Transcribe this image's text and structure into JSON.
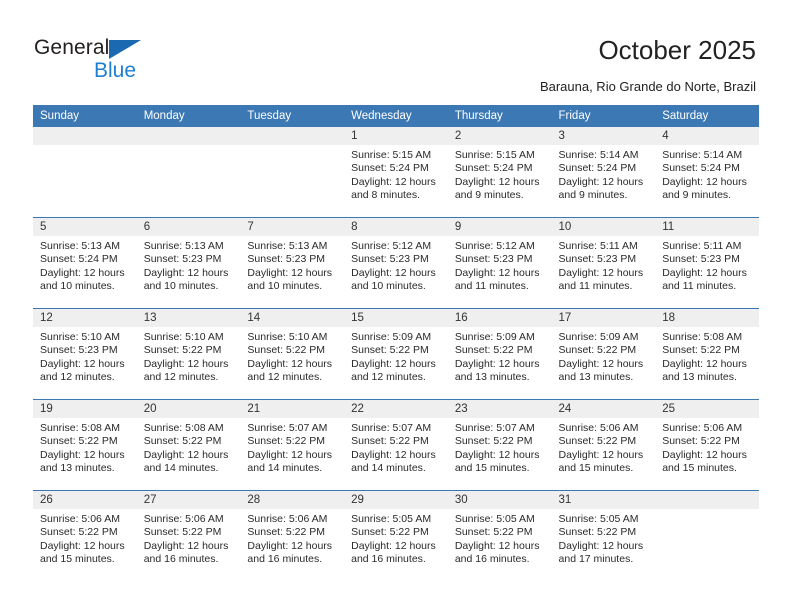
{
  "brand": {
    "line1": "General",
    "line2": "Blue",
    "triangle_color": "#1b69b0",
    "line2_color": "#1f7fd0"
  },
  "header": {
    "title": "October 2025",
    "location": "Barauna, Rio Grande do Norte, Brazil"
  },
  "theme": {
    "header_bg": "#3c78b4",
    "daynum_bg": "#efefef",
    "separator": "#3c78b4",
    "text": "#222222"
  },
  "weekdays": [
    "Sunday",
    "Monday",
    "Tuesday",
    "Wednesday",
    "Thursday",
    "Friday",
    "Saturday"
  ],
  "weeks": [
    [
      {
        "day": "",
        "sunrise": "",
        "sunset": "",
        "daylight": "",
        "daylight2": ""
      },
      {
        "day": "",
        "sunrise": "",
        "sunset": "",
        "daylight": "",
        "daylight2": ""
      },
      {
        "day": "",
        "sunrise": "",
        "sunset": "",
        "daylight": "",
        "daylight2": ""
      },
      {
        "day": "1",
        "sunrise": "Sunrise: 5:15 AM",
        "sunset": "Sunset: 5:24 PM",
        "daylight": "Daylight: 12 hours",
        "daylight2": "and 8 minutes."
      },
      {
        "day": "2",
        "sunrise": "Sunrise: 5:15 AM",
        "sunset": "Sunset: 5:24 PM",
        "daylight": "Daylight: 12 hours",
        "daylight2": "and 9 minutes."
      },
      {
        "day": "3",
        "sunrise": "Sunrise: 5:14 AM",
        "sunset": "Sunset: 5:24 PM",
        "daylight": "Daylight: 12 hours",
        "daylight2": "and 9 minutes."
      },
      {
        "day": "4",
        "sunrise": "Sunrise: 5:14 AM",
        "sunset": "Sunset: 5:24 PM",
        "daylight": "Daylight: 12 hours",
        "daylight2": "and 9 minutes."
      }
    ],
    [
      {
        "day": "5",
        "sunrise": "Sunrise: 5:13 AM",
        "sunset": "Sunset: 5:24 PM",
        "daylight": "Daylight: 12 hours",
        "daylight2": "and 10 minutes."
      },
      {
        "day": "6",
        "sunrise": "Sunrise: 5:13 AM",
        "sunset": "Sunset: 5:23 PM",
        "daylight": "Daylight: 12 hours",
        "daylight2": "and 10 minutes."
      },
      {
        "day": "7",
        "sunrise": "Sunrise: 5:13 AM",
        "sunset": "Sunset: 5:23 PM",
        "daylight": "Daylight: 12 hours",
        "daylight2": "and 10 minutes."
      },
      {
        "day": "8",
        "sunrise": "Sunrise: 5:12 AM",
        "sunset": "Sunset: 5:23 PM",
        "daylight": "Daylight: 12 hours",
        "daylight2": "and 10 minutes."
      },
      {
        "day": "9",
        "sunrise": "Sunrise: 5:12 AM",
        "sunset": "Sunset: 5:23 PM",
        "daylight": "Daylight: 12 hours",
        "daylight2": "and 11 minutes."
      },
      {
        "day": "10",
        "sunrise": "Sunrise: 5:11 AM",
        "sunset": "Sunset: 5:23 PM",
        "daylight": "Daylight: 12 hours",
        "daylight2": "and 11 minutes."
      },
      {
        "day": "11",
        "sunrise": "Sunrise: 5:11 AM",
        "sunset": "Sunset: 5:23 PM",
        "daylight": "Daylight: 12 hours",
        "daylight2": "and 11 minutes."
      }
    ],
    [
      {
        "day": "12",
        "sunrise": "Sunrise: 5:10 AM",
        "sunset": "Sunset: 5:23 PM",
        "daylight": "Daylight: 12 hours",
        "daylight2": "and 12 minutes."
      },
      {
        "day": "13",
        "sunrise": "Sunrise: 5:10 AM",
        "sunset": "Sunset: 5:22 PM",
        "daylight": "Daylight: 12 hours",
        "daylight2": "and 12 minutes."
      },
      {
        "day": "14",
        "sunrise": "Sunrise: 5:10 AM",
        "sunset": "Sunset: 5:22 PM",
        "daylight": "Daylight: 12 hours",
        "daylight2": "and 12 minutes."
      },
      {
        "day": "15",
        "sunrise": "Sunrise: 5:09 AM",
        "sunset": "Sunset: 5:22 PM",
        "daylight": "Daylight: 12 hours",
        "daylight2": "and 12 minutes."
      },
      {
        "day": "16",
        "sunrise": "Sunrise: 5:09 AM",
        "sunset": "Sunset: 5:22 PM",
        "daylight": "Daylight: 12 hours",
        "daylight2": "and 13 minutes."
      },
      {
        "day": "17",
        "sunrise": "Sunrise: 5:09 AM",
        "sunset": "Sunset: 5:22 PM",
        "daylight": "Daylight: 12 hours",
        "daylight2": "and 13 minutes."
      },
      {
        "day": "18",
        "sunrise": "Sunrise: 5:08 AM",
        "sunset": "Sunset: 5:22 PM",
        "daylight": "Daylight: 12 hours",
        "daylight2": "and 13 minutes."
      }
    ],
    [
      {
        "day": "19",
        "sunrise": "Sunrise: 5:08 AM",
        "sunset": "Sunset: 5:22 PM",
        "daylight": "Daylight: 12 hours",
        "daylight2": "and 13 minutes."
      },
      {
        "day": "20",
        "sunrise": "Sunrise: 5:08 AM",
        "sunset": "Sunset: 5:22 PM",
        "daylight": "Daylight: 12 hours",
        "daylight2": "and 14 minutes."
      },
      {
        "day": "21",
        "sunrise": "Sunrise: 5:07 AM",
        "sunset": "Sunset: 5:22 PM",
        "daylight": "Daylight: 12 hours",
        "daylight2": "and 14 minutes."
      },
      {
        "day": "22",
        "sunrise": "Sunrise: 5:07 AM",
        "sunset": "Sunset: 5:22 PM",
        "daylight": "Daylight: 12 hours",
        "daylight2": "and 14 minutes."
      },
      {
        "day": "23",
        "sunrise": "Sunrise: 5:07 AM",
        "sunset": "Sunset: 5:22 PM",
        "daylight": "Daylight: 12 hours",
        "daylight2": "and 15 minutes."
      },
      {
        "day": "24",
        "sunrise": "Sunrise: 5:06 AM",
        "sunset": "Sunset: 5:22 PM",
        "daylight": "Daylight: 12 hours",
        "daylight2": "and 15 minutes."
      },
      {
        "day": "25",
        "sunrise": "Sunrise: 5:06 AM",
        "sunset": "Sunset: 5:22 PM",
        "daylight": "Daylight: 12 hours",
        "daylight2": "and 15 minutes."
      }
    ],
    [
      {
        "day": "26",
        "sunrise": "Sunrise: 5:06 AM",
        "sunset": "Sunset: 5:22 PM",
        "daylight": "Daylight: 12 hours",
        "daylight2": "and 15 minutes."
      },
      {
        "day": "27",
        "sunrise": "Sunrise: 5:06 AM",
        "sunset": "Sunset: 5:22 PM",
        "daylight": "Daylight: 12 hours",
        "daylight2": "and 16 minutes."
      },
      {
        "day": "28",
        "sunrise": "Sunrise: 5:06 AM",
        "sunset": "Sunset: 5:22 PM",
        "daylight": "Daylight: 12 hours",
        "daylight2": "and 16 minutes."
      },
      {
        "day": "29",
        "sunrise": "Sunrise: 5:05 AM",
        "sunset": "Sunset: 5:22 PM",
        "daylight": "Daylight: 12 hours",
        "daylight2": "and 16 minutes."
      },
      {
        "day": "30",
        "sunrise": "Sunrise: 5:05 AM",
        "sunset": "Sunset: 5:22 PM",
        "daylight": "Daylight: 12 hours",
        "daylight2": "and 16 minutes."
      },
      {
        "day": "31",
        "sunrise": "Sunrise: 5:05 AM",
        "sunset": "Sunset: 5:22 PM",
        "daylight": "Daylight: 12 hours",
        "daylight2": "and 17 minutes."
      },
      {
        "day": "",
        "sunrise": "",
        "sunset": "",
        "daylight": "",
        "daylight2": ""
      }
    ]
  ]
}
